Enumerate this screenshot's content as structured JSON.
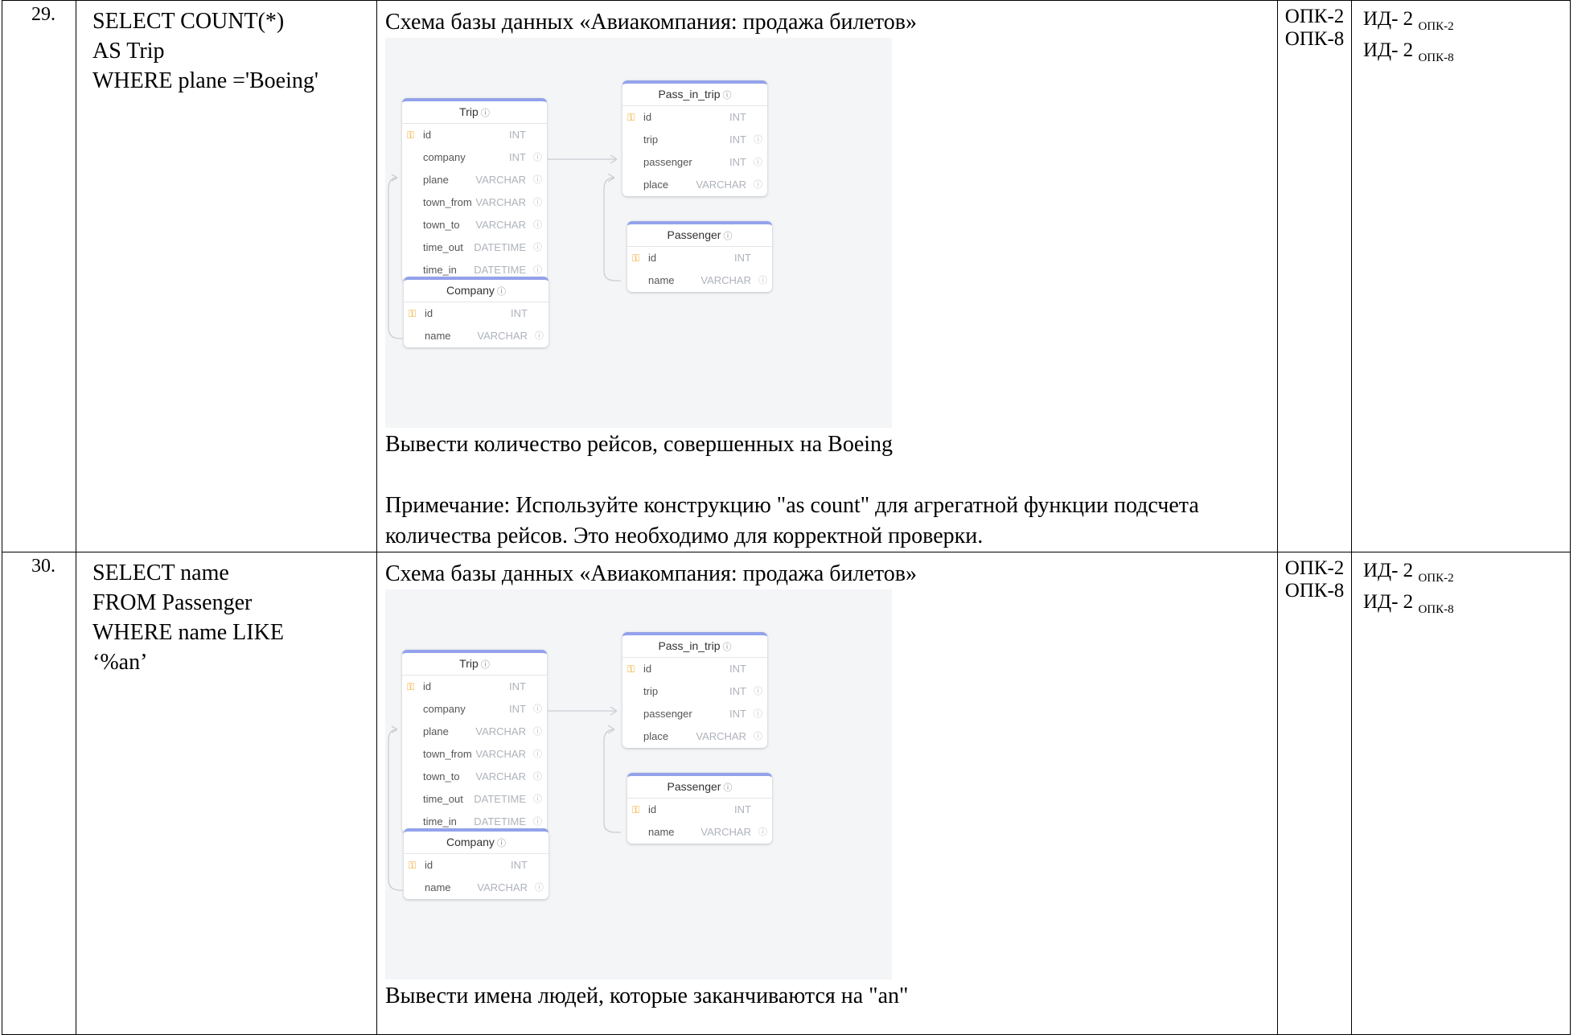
{
  "rows": [
    {
      "number": "29.",
      "sql": "SELECT COUNT(*)\nAS Trip\nWHERE plane ='Boeing'",
      "schema_caption": "Схема базы данных «Авиакомпания: продажа билетов»",
      "task": "Вывести количество рейсов, совершенных на Boeing",
      "note": "Примечание: Используйте конструкцию \"as count\" для агрегатной функции подсчета количества рейсов. Это необходимо для корректной проверки.",
      "competencies": [
        "ОПК-2",
        "ОПК-8"
      ],
      "indicators": [
        {
          "label": "ИД- 2",
          "sub": "ОПК-2"
        },
        {
          "label": "ИД- 2",
          "sub": "ОПК-8"
        }
      ]
    },
    {
      "number": "30.",
      "sql": "SELECT name\nFROM Passenger\nWHERE name LIKE\n‘%an’",
      "schema_caption": "Схема базы данных «Авиакомпания: продажа билетов»",
      "task": "Вывести имена людей, которые заканчиваются на \"an\"",
      "note": "",
      "competencies": [
        "ОПК-2",
        "ОПК-8"
      ],
      "indicators": [
        {
          "label": "ИД- 2",
          "sub": "ОПК-2"
        },
        {
          "label": "ИД- 2",
          "sub": "ОПК-8"
        }
      ]
    }
  ],
  "schema": {
    "help_icon": "question-circle-icon",
    "key_icon": "key-icon",
    "colors": {
      "header_accent": "#94a2ea",
      "key": "#f0a21a",
      "canvas": "#f3f5f7"
    },
    "tables": {
      "trip": {
        "name": "Trip",
        "columns": [
          {
            "name": "id",
            "type": "INT",
            "key": true
          },
          {
            "name": "company",
            "type": "INT"
          },
          {
            "name": "plane",
            "type": "VARCHAR"
          },
          {
            "name": "town_from",
            "type": "VARCHAR"
          },
          {
            "name": "town_to",
            "type": "VARCHAR"
          },
          {
            "name": "time_out",
            "type": "DATETIME"
          },
          {
            "name": "time_in",
            "type": "DATETIME"
          }
        ]
      },
      "pass_in_trip": {
        "name": "Pass_in_trip",
        "columns": [
          {
            "name": "id",
            "type": "INT",
            "key": true
          },
          {
            "name": "trip",
            "type": "INT"
          },
          {
            "name": "passenger",
            "type": "INT"
          },
          {
            "name": "place",
            "type": "VARCHAR"
          }
        ]
      },
      "passenger": {
        "name": "Passenger",
        "columns": [
          {
            "name": "id",
            "type": "INT",
            "key": true
          },
          {
            "name": "name",
            "type": "VARCHAR"
          }
        ]
      },
      "company": {
        "name": "Company",
        "columns": [
          {
            "name": "id",
            "type": "INT",
            "key": true
          },
          {
            "name": "name",
            "type": "VARCHAR"
          }
        ]
      }
    }
  }
}
